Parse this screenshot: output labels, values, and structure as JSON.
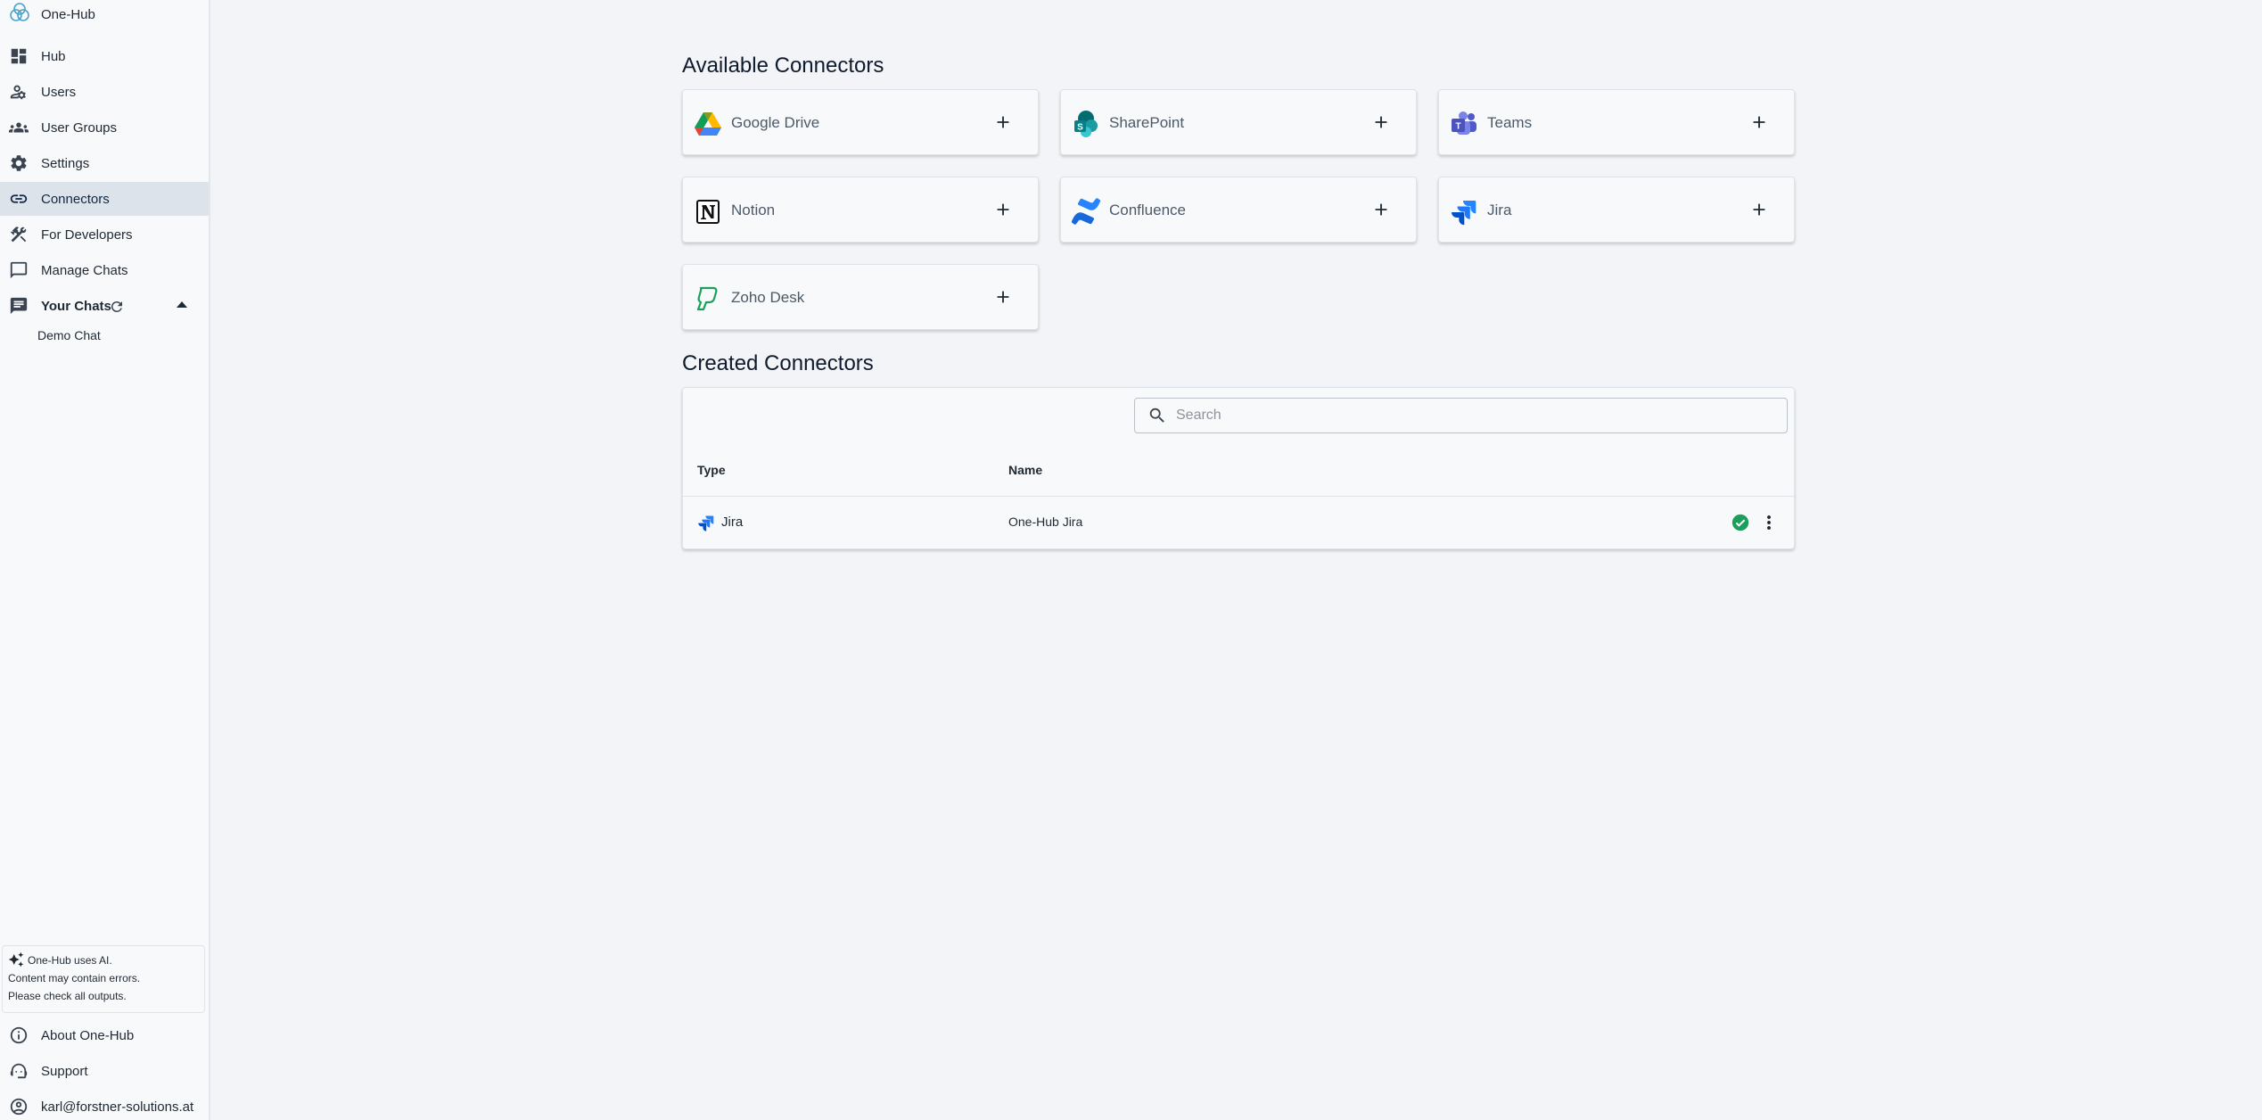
{
  "app": {
    "title": "One-Hub"
  },
  "sidebar": {
    "items": [
      {
        "label": "Hub",
        "icon": "dashboard-icon"
      },
      {
        "label": "Users",
        "icon": "user-settings-icon"
      },
      {
        "label": "User Groups",
        "icon": "groups-icon"
      },
      {
        "label": "Settings",
        "icon": "gear-icon"
      },
      {
        "label": "Connectors",
        "icon": "link-icon",
        "active": true
      },
      {
        "label": "For Developers",
        "icon": "tools-icon"
      },
      {
        "label": "Manage Chats",
        "icon": "chat-bubble-icon"
      }
    ],
    "your_chats": {
      "label": "Your Chats",
      "chats": [
        "Demo Chat"
      ]
    },
    "notice": {
      "line1": "One-Hub uses AI.",
      "line2": "Content may contain errors.",
      "line3": "Please check all outputs."
    },
    "bottom": [
      {
        "label": "About One-Hub",
        "icon": "info-icon"
      },
      {
        "label": "Support",
        "icon": "headset-icon"
      },
      {
        "label": "karl@forstner-solutions.at",
        "icon": "account-icon"
      }
    ]
  },
  "available": {
    "title": "Available Connectors",
    "connectors": [
      {
        "name": "Google Drive",
        "icon": "google-drive-icon"
      },
      {
        "name": "SharePoint",
        "icon": "sharepoint-icon"
      },
      {
        "name": "Teams",
        "icon": "teams-icon"
      },
      {
        "name": "Notion",
        "icon": "notion-icon"
      },
      {
        "name": "Confluence",
        "icon": "confluence-icon"
      },
      {
        "name": "Jira",
        "icon": "jira-icon"
      },
      {
        "name": "Zoho Desk",
        "icon": "zoho-desk-icon"
      }
    ]
  },
  "created": {
    "title": "Created Connectors",
    "search": {
      "placeholder": "Search",
      "value": ""
    },
    "columns": {
      "type": "Type",
      "name": "Name"
    },
    "rows": [
      {
        "type": "Jira",
        "name": "One-Hub Jira",
        "status": "active"
      }
    ]
  },
  "colors": {
    "accent": "#0f2742",
    "success": "#1aa05a",
    "jira": "#2684ff"
  }
}
